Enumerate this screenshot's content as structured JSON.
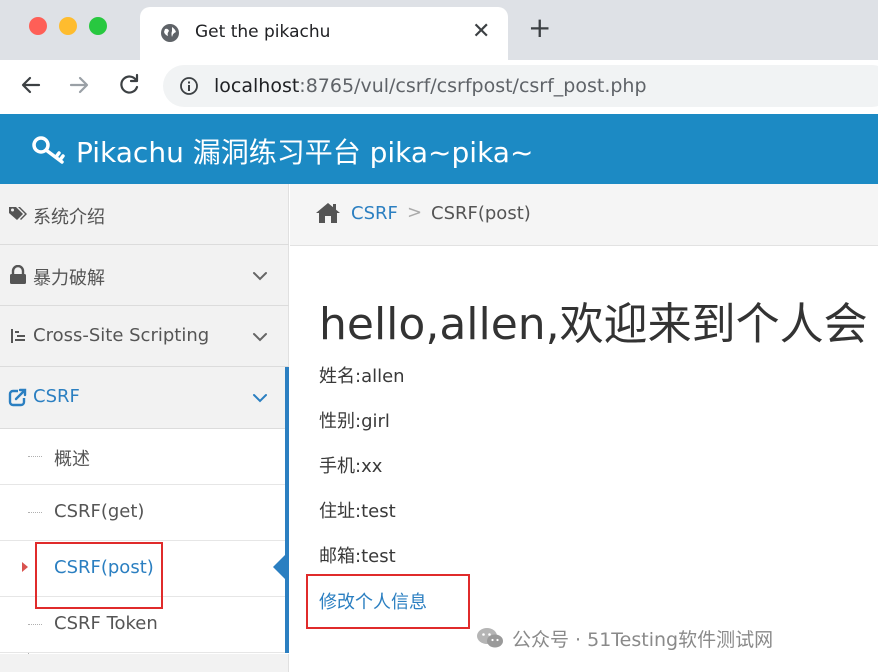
{
  "browser": {
    "tab_title": "Get the pikachu",
    "url_host": "localhost",
    "url_path": ":8765/vul/csrf/csrfpost/csrf_post.php"
  },
  "app": {
    "title": "Pikachu 漏洞练习平台 pika~pika~",
    "header_color": "#1c8ac4"
  },
  "sidebar": {
    "items": [
      {
        "label": "系统介绍",
        "icon": "tags-icon"
      },
      {
        "label": "暴力破解",
        "icon": "lock-icon"
      },
      {
        "label": "Cross-Site Scripting",
        "icon": "list-icon"
      },
      {
        "label": "CSRF",
        "icon": "share-icon"
      }
    ],
    "submenu": [
      {
        "label": "概述"
      },
      {
        "label": "CSRF(get)"
      },
      {
        "label": "CSRF(post)"
      },
      {
        "label": "CSRF Token"
      }
    ]
  },
  "breadcrumb": {
    "link": "CSRF",
    "separator": ">",
    "current": "CSRF(post)"
  },
  "main": {
    "welcome": "hello,allen,欢迎来到个人会",
    "fields": [
      "姓名:allen",
      "性别:girl",
      "手机:xx",
      "住址:test",
      "邮箱:test"
    ],
    "edit_link": "修改个人信息"
  },
  "watermark": {
    "text": "公众号 · 51Testing软件测试网"
  },
  "colors": {
    "accent": "#2b7fc1",
    "highlight": "#e02b2b"
  }
}
